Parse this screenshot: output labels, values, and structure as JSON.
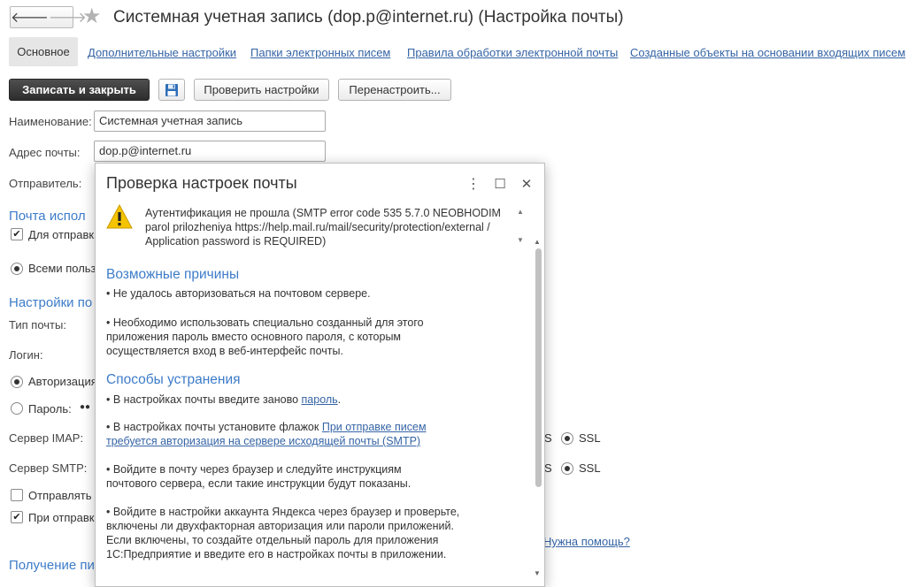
{
  "window": {
    "title": "Системная учетная запись (dop.p@internet.ru) (Настройка почты)"
  },
  "nav": {
    "back_icon": "arrow-left-icon",
    "forward_icon": "arrow-right-icon",
    "back": "🡐",
    "forward": "🡒",
    "star": "★"
  },
  "tabs": {
    "main": "Основное",
    "links": [
      "Дополнительные настройки",
      "Папки электронных писем",
      "Правила обработки электронной почты",
      "Созданные объекты на основании входящих писем"
    ]
  },
  "toolbar": {
    "save_close": "Записать и закрыть",
    "check_settings": "Проверить настройки",
    "reconfigure": "Перенастроить..."
  },
  "form": {
    "name_label": "Наименование:",
    "name_value": "Системная учетная запись",
    "email_label": "Адрес почты:",
    "email_value": "dop.p@internet.ru",
    "sender_label": "Отправитель:",
    "section_usage": "Почта испол",
    "check_sending": "Для отправк",
    "radio_all_users": "Всеми польз",
    "section_settings": "Настройки по",
    "mail_type_label": "Тип почты:",
    "login_label": "Логин:",
    "radio_auth": "Авторизация",
    "radio_password": "Пароль:",
    "password_mask": "●●",
    "imap_label": "Сервер IMAP:",
    "imap_ssl_partial": "S",
    "imap_ssl": "SSL",
    "smtp_label": "Сервер SMTP:",
    "smtp_ssl_partial": "S",
    "smtp_ssl": "SSL",
    "check_send_copy": "Отправлять",
    "check_on_send": "При отправк",
    "help_link": "Нужна помощь?",
    "section_receive": "Получение пи"
  },
  "dialog": {
    "title": "Проверка настроек почты",
    "more": "⋮",
    "maximize": "☐",
    "close": "✕",
    "error_text": "Аутентификация не прошла (SMTP error code 535 5.7.0 NEOBHODIM parol prilozheniya https://help.mail.ru/mail/security/protection/external / Application password is REQUIRED)",
    "scroll_up": "▲",
    "scroll_down": "▼",
    "reasons_head": "Возможные причины",
    "reason_1": "• Не удалось авторизоваться на почтовом сервере.",
    "reason_2": "• Необходимо использовать специально созданный для этого приложения пароль вместо основного пароля, с которым осуществляется вход в веб-интерфейс почты.",
    "fixes_head": "Способы устранения",
    "fix_1_prefix": "• В настройках почты введите заново ",
    "fix_1_link": "пароль",
    "fix_1_suffix": ".",
    "fix_2_prefix": "• В настройках почты установите флажок ",
    "fix_2_link": "При отправке писем требуется авторизация на сервере исходящей почты (SMTP)",
    "fix_3": "• Войдите в почту через браузер и следуйте инструкциям почтового сервера, если такие инструкции будут показаны.",
    "fix_4": "• Войдите в настройки аккаунта Яндекса через браузер и проверьте, включены ли двухфакторная авторизация или пароли приложений. Если включены, то создайте отдельный пароль для приложения 1С:Предприятие и введите его в настройках почты в приложении."
  },
  "colors": {
    "accent": "#3d7cc9",
    "link": "#3564a5",
    "primary_button": "#333333",
    "warning": "#f5c400"
  }
}
